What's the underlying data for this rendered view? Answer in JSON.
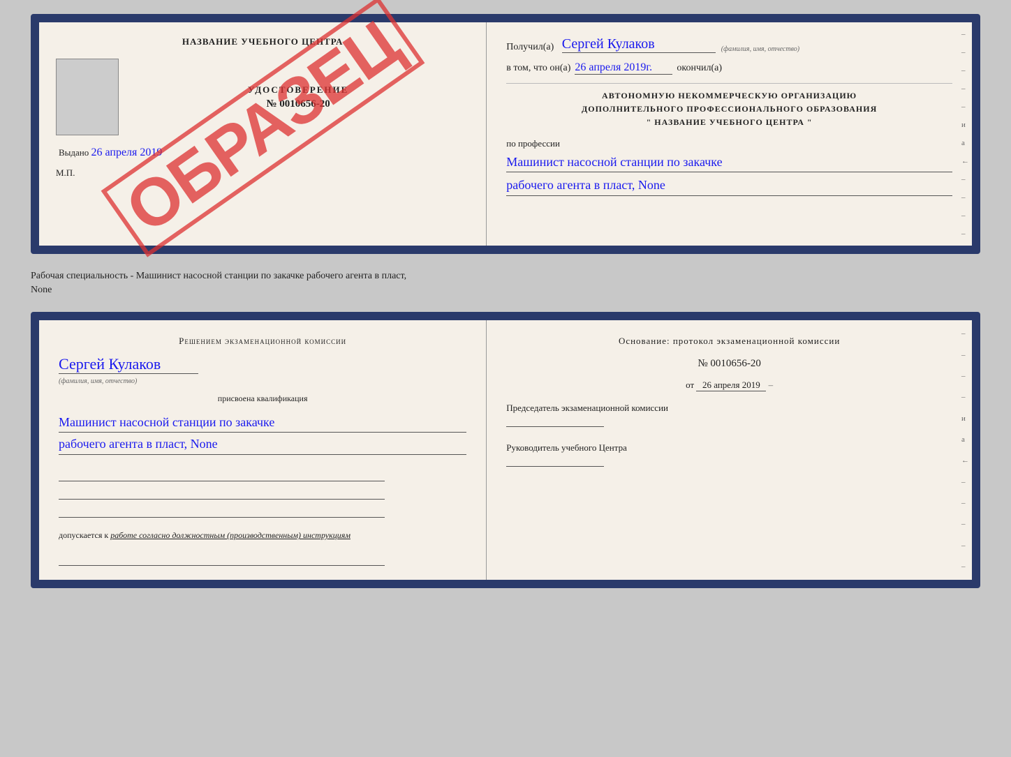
{
  "top_doc": {
    "left": {
      "title": "НАЗВАНИЕ УЧЕБНОГО ЦЕНТРА",
      "stamp_label": "УДОСТОВЕРЕНИЕ",
      "stamp_number": "№ 0010656-20",
      "obrazec": "ОБРАЗЕЦ",
      "issued_label": "Выдано",
      "issued_date": "26 апреля 2019",
      "mp_label": "М.П."
    },
    "right": {
      "received_prefix": "Получил(а)",
      "received_name": "Сергей Кулаков",
      "name_hint": "(фамилия, имя, отчество)",
      "date_prefix": "в том, что он(а)",
      "date_value": "26 апреля 2019г.",
      "date_suffix": "окончил(а)",
      "org_line1": "АВТОНОМНУЮ НЕКОММЕРЧЕСКУЮ ОРГАНИЗАЦИЮ",
      "org_line2": "ДОПОЛНИТЕЛЬНОГО ПРОФЕССИОНАЛЬНОГО ОБРАЗОВАНИЯ",
      "org_line3": "\"    НАЗВАНИЕ УЧЕБНОГО ЦЕНТРА    \"",
      "profession_prefix": "по профессии",
      "profession_line1": "Машинист насосной станции по закачке",
      "profession_line2": "рабочего агента в пласт, None",
      "marks": [
        "–",
        "–",
        "–",
        "–",
        "–",
        "и",
        "а",
        "←",
        "–",
        "–",
        "–",
        "–"
      ]
    }
  },
  "separator": {
    "text": "Рабочая специальность - Машинист насосной станции по закачке рабочего агента в пласт,",
    "text2": "None"
  },
  "bottom_doc": {
    "left": {
      "committee_text": "Решением экзаменационной комиссии",
      "person_name": "Сергей Кулаков",
      "person_hint": "(фамилия, имя, отчество)",
      "assigned_text": "присвоена квалификация",
      "qual_line1": "Машинист насосной станции по закачке",
      "qual_line2": "рабочего агента в пласт, None",
      "allowed_prefix": "допускается к",
      "allowed_text": "работе согласно должностным (производственным) инструкциям"
    },
    "right": {
      "basis_text": "Основание: протокол экзаменационной комиссии",
      "protocol_number": "№ 0010656-20",
      "protocol_date_prefix": "от",
      "protocol_date": "26 апреля 2019",
      "chairman_label": "Председатель экзаменационной комиссии",
      "director_label": "Руководитель учебного Центра",
      "marks": [
        "–",
        "–",
        "–",
        "–",
        "и",
        "а",
        "←",
        "–",
        "–",
        "–",
        "–",
        "–"
      ]
    }
  }
}
